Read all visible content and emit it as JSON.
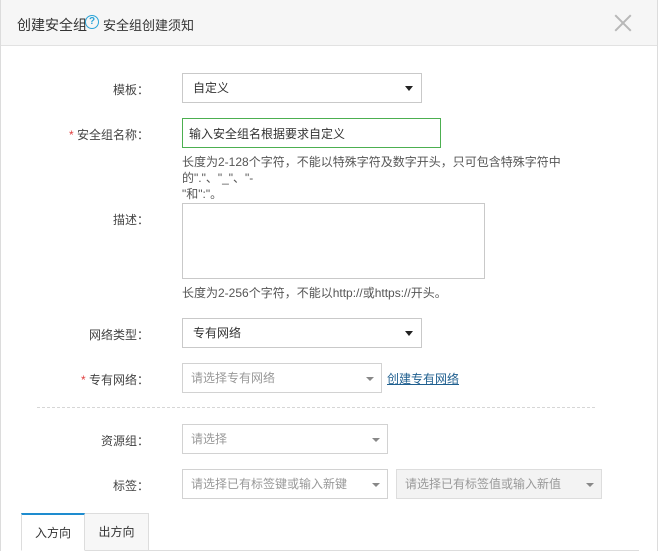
{
  "header": {
    "title": "创建安全组",
    "help_icon": "question-circle-icon",
    "help_link": "安全组创建须知",
    "close_icon": "close-icon"
  },
  "form": {
    "template": {
      "label": "模板：",
      "value": "自定义"
    },
    "name": {
      "required_mark": "*",
      "label": "安全组名称：",
      "value": "输入安全组名根据要求自定义",
      "hint_line1": "长度为2-128个字符，不能以特殊字符及数字开头，只可包含特殊字符中的\".\"、\"_\"、\"-",
      "hint_line2": "\"和\":\"。"
    },
    "description": {
      "label": "描述：",
      "value": "",
      "hint": "长度为2-256个字符，不能以http://或https://开头。"
    },
    "network_type": {
      "label": "网络类型：",
      "value": "专有网络"
    },
    "vpc": {
      "required_mark": "*",
      "label": "专有网络：",
      "placeholder": "请选择专有网络",
      "create_link": "创建专有网络"
    },
    "resource_group": {
      "label": "资源组：",
      "placeholder": "请选择"
    },
    "tags": {
      "label": "标签：",
      "key_placeholder": "请选择已有标签键或输入新键",
      "value_placeholder": "请选择已有标签值或输入新值"
    }
  },
  "tabs": [
    {
      "label": "入方向",
      "active": true
    },
    {
      "label": "出方向",
      "active": false
    }
  ],
  "colors": {
    "accent_blue": "#1e8ccf",
    "input_focus_green": "#4caf50",
    "required_red": "#e03e3e",
    "link": "#1f5f8f"
  }
}
